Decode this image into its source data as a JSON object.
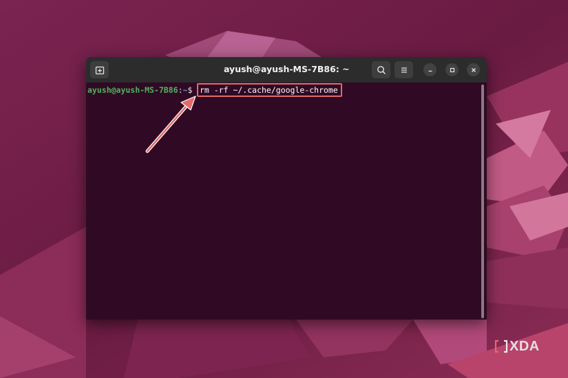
{
  "window": {
    "title": "ayush@ayush-MS-7B86: ~"
  },
  "terminal": {
    "prompt_user": "ayush@ayush-MS-7B86",
    "prompt_colon": ":",
    "prompt_path": "~",
    "prompt_symbol": "$",
    "command": "rm -rf ~/.cache/google-chrome"
  },
  "watermark": {
    "brand": "XDA"
  },
  "colors": {
    "terminal_bg": "#300a24",
    "titlebar_bg": "#2c2c2c",
    "prompt_user": "#4fb35d",
    "prompt_path": "#5b8fd6",
    "highlight": "#e36a6a",
    "wallpaper": "#6e1e45"
  },
  "icons": [
    "new-tab-icon",
    "search-icon",
    "hamburger-menu-icon",
    "minimize-icon",
    "maximize-icon",
    "close-icon",
    "xda-logo-icon"
  ]
}
